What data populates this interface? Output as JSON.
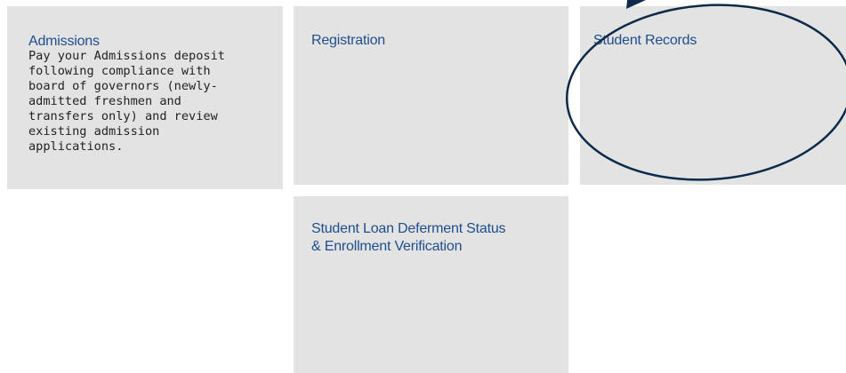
{
  "tiles": {
    "admissions": {
      "title": "Admissions",
      "description": "Pay your Admissions deposit\nfollowing compliance with\nboard of governors (newly-\nadmitted freshmen and\ntransfers only) and review\nexisting admission\napplications."
    },
    "registration": {
      "title": "Registration"
    },
    "student_records": {
      "title": "Student Records"
    },
    "loan_deferment": {
      "title": "Student Loan Deferment Status\n& Enrollment Verification"
    }
  },
  "colors": {
    "tile_background": "#e3e3e3",
    "title_link": "#1f4e8c",
    "annotation_stroke": "#0d2a4a"
  },
  "annotation": {
    "shape": "ellipse-circle-highlight",
    "target": "student_records",
    "icon": "arrow-pointer"
  }
}
